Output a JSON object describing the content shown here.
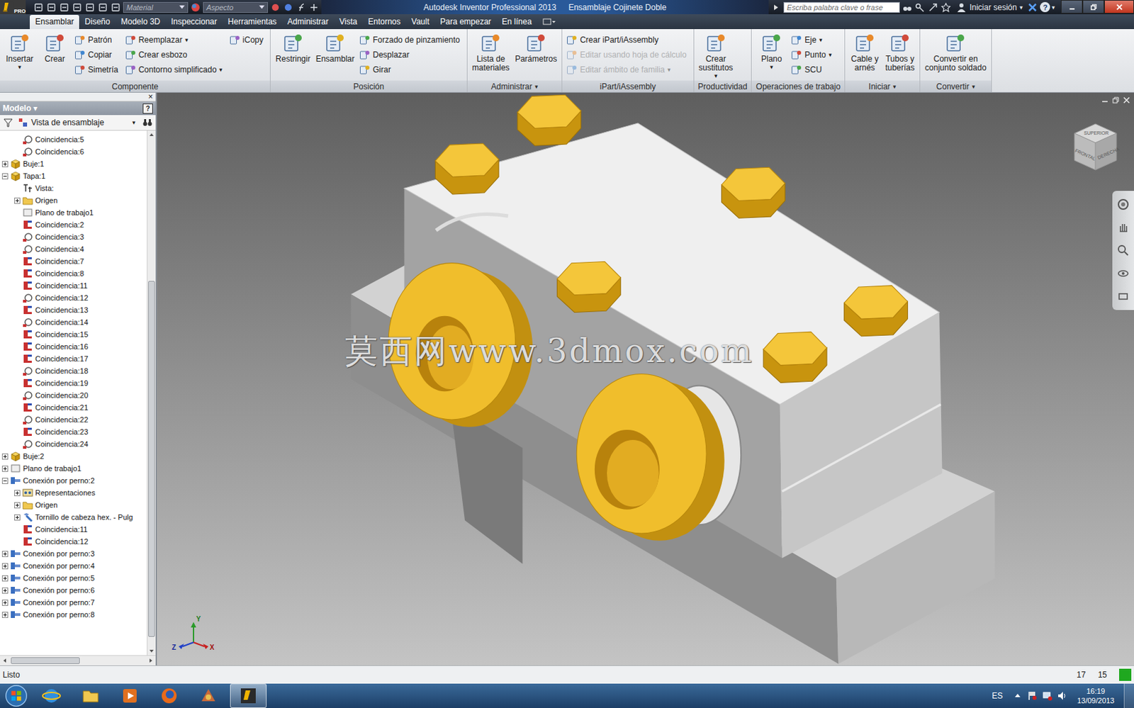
{
  "app": {
    "badge": "PRO",
    "material": "Material",
    "aspect": "Aspecto",
    "title": "Autodesk Inventor Professional 2013",
    "document": "Ensamblaje Cojinete Doble",
    "search_placeholder": "Escriba palabra clave o frase",
    "sign_in": "Iniciar sesión",
    "sign_in_arrow": "▾",
    "help": "?",
    "help_arrow": "▾"
  },
  "tabs": [
    {
      "label": "Ensamblar",
      "selected": true
    },
    {
      "label": "Diseño",
      "selected": false
    },
    {
      "label": "Modelo 3D",
      "selected": false
    },
    {
      "label": "Inspeccionar",
      "selected": false
    },
    {
      "label": "Herramientas",
      "selected": false
    },
    {
      "label": "Administrar",
      "selected": false
    },
    {
      "label": "Vista",
      "selected": false
    },
    {
      "label": "Entornos",
      "selected": false
    },
    {
      "label": "Vault",
      "selected": false
    },
    {
      "label": "Para empezar",
      "selected": false
    },
    {
      "label": "En línea",
      "selected": false
    }
  ],
  "ribbon": [
    {
      "label": "Componente",
      "arrow": "",
      "columns": [
        {
          "kind": "large",
          "buttons": [
            {
              "lines": [
                "Insertar"
              ],
              "arrow": "▾",
              "disabled": false
            }
          ]
        },
        {
          "kind": "large",
          "buttons": [
            {
              "lines": [
                "Crear"
              ],
              "arrow": "",
              "disabled": false
            }
          ]
        },
        {
          "kind": "small",
          "buttons": [
            {
              "label": "Patrón",
              "arrow": "",
              "disabled": false
            },
            {
              "label": "Copiar",
              "arrow": "",
              "disabled": false
            },
            {
              "label": "Simetría",
              "arrow": "",
              "disabled": false
            }
          ]
        },
        {
          "kind": "small",
          "buttons": [
            {
              "label": "Reemplazar",
              "arrow": "▾",
              "disabled": false
            },
            {
              "label": "Crear esbozo",
              "arrow": "",
              "disabled": false
            },
            {
              "label": "Contorno simplificado",
              "arrow": "▾",
              "disabled": false
            }
          ]
        },
        {
          "kind": "small",
          "buttons": [
            {
              "label": "iCopy",
              "arrow": "",
              "disabled": false
            }
          ]
        }
      ]
    },
    {
      "label": "Posición",
      "arrow": "",
      "columns": [
        {
          "kind": "large",
          "buttons": [
            {
              "lines": [
                "Restringir"
              ],
              "arrow": "",
              "disabled": false
            }
          ]
        },
        {
          "kind": "large",
          "buttons": [
            {
              "lines": [
                "Ensamblar"
              ],
              "arrow": "",
              "disabled": false
            }
          ]
        },
        {
          "kind": "small",
          "buttons": [
            {
              "label": "Forzado de pinzamiento",
              "arrow": "",
              "disabled": false
            },
            {
              "label": "Desplazar",
              "arrow": "",
              "disabled": false
            },
            {
              "label": "Girar",
              "arrow": "",
              "disabled": false
            }
          ]
        }
      ]
    },
    {
      "label": "Administrar",
      "arrow": "▾",
      "columns": [
        {
          "kind": "large",
          "buttons": [
            {
              "lines": [
                "Lista de",
                "materiales"
              ],
              "arrow": "",
              "disabled": false
            }
          ]
        },
        {
          "kind": "large",
          "buttons": [
            {
              "lines": [
                "Parámetros"
              ],
              "arrow": "",
              "disabled": false
            }
          ]
        }
      ]
    },
    {
      "label": "iPart/iAssembly",
      "arrow": "",
      "columns": [
        {
          "kind": "small",
          "buttons": [
            {
              "label": "Crear iPart/iAssembly",
              "arrow": "",
              "disabled": false
            },
            {
              "label": "Editar usando hoja de cálculo",
              "arrow": "",
              "disabled": true
            },
            {
              "label": "Editar ámbito de familia",
              "arrow": "▾",
              "disabled": true
            }
          ]
        }
      ]
    },
    {
      "label": "Productividad",
      "arrow": "",
      "columns": [
        {
          "kind": "large",
          "buttons": [
            {
              "lines": [
                "Crear",
                "sustitutos"
              ],
              "arrow": "▾",
              "disabled": false
            }
          ]
        }
      ]
    },
    {
      "label": "Operaciones de trabajo",
      "arrow": "",
      "columns": [
        {
          "kind": "large",
          "buttons": [
            {
              "lines": [
                "Plano"
              ],
              "arrow": "▾",
              "disabled": false
            }
          ]
        },
        {
          "kind": "small",
          "buttons": [
            {
              "label": "Eje",
              "arrow": "▾",
              "disabled": false
            },
            {
              "label": "Punto",
              "arrow": "▾",
              "disabled": false
            },
            {
              "label": "SCU",
              "arrow": "",
              "disabled": false
            }
          ]
        }
      ]
    },
    {
      "label": "Iniciar",
      "arrow": "▾",
      "columns": [
        {
          "kind": "large",
          "buttons": [
            {
              "lines": [
                "Cable y",
                "arnés"
              ],
              "arrow": "",
              "disabled": false
            }
          ]
        },
        {
          "kind": "large",
          "buttons": [
            {
              "lines": [
                "Tubos y",
                "tuberías"
              ],
              "arrow": "",
              "disabled": false
            }
          ]
        }
      ]
    },
    {
      "label": "Convertir",
      "arrow": "▾",
      "columns": [
        {
          "kind": "large",
          "buttons": [
            {
              "lines": [
                "Convertir en",
                "conjunto soldado"
              ],
              "arrow": "",
              "disabled": false
            }
          ]
        }
      ]
    }
  ],
  "browser": {
    "close": "×",
    "title": "Modelo",
    "title_arrow": "▾",
    "help": "?",
    "view": "Vista de ensamblaje",
    "view_arrow": "▾",
    "thumb_start": 0.28,
    "thumb_size": 0.7,
    "items": [
      {
        "label": "Coincidencia:5",
        "kind": "axis",
        "depth": 1,
        "expandable": false,
        "expanded": false
      },
      {
        "label": "Coincidencia:6",
        "kind": "axis",
        "depth": 1,
        "expandable": false,
        "expanded": false
      },
      {
        "label": "Buje:1",
        "kind": "part",
        "depth": 0,
        "expandable": true,
        "expanded": false
      },
      {
        "label": "Tapa:1",
        "kind": "part",
        "depth": 0,
        "expandable": true,
        "expanded": true
      },
      {
        "label": "Vista:",
        "kind": "view",
        "depth": 1,
        "expandable": false,
        "expanded": false
      },
      {
        "label": "Origen",
        "kind": "folder",
        "depth": 1,
        "expandable": true,
        "expanded": false
      },
      {
        "label": "Plano de trabajo1",
        "kind": "plane",
        "depth": 1,
        "expandable": false,
        "expanded": false
      },
      {
        "label": "Coincidencia:2",
        "kind": "flush",
        "depth": 1,
        "expandable": false,
        "expanded": false
      },
      {
        "label": "Coincidencia:3",
        "kind": "axis",
        "depth": 1,
        "expandable": false,
        "expanded": false
      },
      {
        "label": "Coincidencia:4",
        "kind": "axis",
        "depth": 1,
        "expandable": false,
        "expanded": false
      },
      {
        "label": "Coincidencia:7",
        "kind": "flush",
        "depth": 1,
        "expandable": false,
        "expanded": false
      },
      {
        "label": "Coincidencia:8",
        "kind": "flush",
        "depth": 1,
        "expandable": false,
        "expanded": false
      },
      {
        "label": "Coincidencia:11",
        "kind": "flush",
        "depth": 1,
        "expandable": false,
        "expanded": false
      },
      {
        "label": "Coincidencia:12",
        "kind": "axis",
        "depth": 1,
        "expandable": false,
        "expanded": false
      },
      {
        "label": "Coincidencia:13",
        "kind": "flush",
        "depth": 1,
        "expandable": false,
        "expanded": false
      },
      {
        "label": "Coincidencia:14",
        "kind": "axis",
        "depth": 1,
        "expandable": false,
        "expanded": false
      },
      {
        "label": "Coincidencia:15",
        "kind": "flush",
        "depth": 1,
        "expandable": false,
        "expanded": false
      },
      {
        "label": "Coincidencia:16",
        "kind": "flush",
        "depth": 1,
        "expandable": false,
        "expanded": false
      },
      {
        "label": "Coincidencia:17",
        "kind": "flush",
        "depth": 1,
        "expandable": false,
        "expanded": false
      },
      {
        "label": "Coincidencia:18",
        "kind": "axis",
        "depth": 1,
        "expandable": false,
        "expanded": false
      },
      {
        "label": "Coincidencia:19",
        "kind": "flush",
        "depth": 1,
        "expandable": false,
        "expanded": false
      },
      {
        "label": "Coincidencia:20",
        "kind": "axis",
        "depth": 1,
        "expandable": false,
        "expanded": false
      },
      {
        "label": "Coincidencia:21",
        "kind": "flush",
        "depth": 1,
        "expandable": false,
        "expanded": false
      },
      {
        "label": "Coincidencia:22",
        "kind": "axis",
        "depth": 1,
        "expandable": false,
        "expanded": false
      },
      {
        "label": "Coincidencia:23",
        "kind": "flush",
        "depth": 1,
        "expandable": false,
        "expanded": false
      },
      {
        "label": "Coincidencia:24",
        "kind": "axis",
        "depth": 1,
        "expandable": false,
        "expanded": false
      },
      {
        "label": "Buje:2",
        "kind": "part",
        "depth": 0,
        "expandable": true,
        "expanded": false
      },
      {
        "label": "Plano de trabajo1",
        "kind": "plane",
        "depth": 0,
        "expandable": true,
        "expanded": false
      },
      {
        "label": "Conexión por perno:2",
        "kind": "bolt",
        "depth": 0,
        "expandable": true,
        "expanded": true
      },
      {
        "label": "Representaciones",
        "kind": "repr",
        "depth": 1,
        "expandable": true,
        "expanded": false
      },
      {
        "label": "Origen",
        "kind": "folder",
        "depth": 1,
        "expandable": true,
        "expanded": false
      },
      {
        "label": "Tornillo de cabeza hex. - Pulg",
        "kind": "screw",
        "depth": 1,
        "expandable": true,
        "expanded": false
      },
      {
        "label": "Coincidencia:11",
        "kind": "flush",
        "depth": 1,
        "expandable": false,
        "expanded": false
      },
      {
        "label": "Coincidencia:12",
        "kind": "flush",
        "depth": 1,
        "expandable": false,
        "expanded": false
      },
      {
        "label": "Conexión por perno:3",
        "kind": "bolt",
        "depth": 0,
        "expandable": true,
        "expanded": false
      },
      {
        "label": "Conexión por perno:4",
        "kind": "bolt",
        "depth": 0,
        "expandable": true,
        "expanded": false
      },
      {
        "label": "Conexión por perno:5",
        "kind": "bolt",
        "depth": 0,
        "expandable": true,
        "expanded": false
      },
      {
        "label": "Conexión por perno:6",
        "kind": "bolt",
        "depth": 0,
        "expandable": true,
        "expanded": false
      },
      {
        "label": "Conexión por perno:7",
        "kind": "bolt",
        "depth": 0,
        "expandable": true,
        "expanded": false
      },
      {
        "label": "Conexión por perno:8",
        "kind": "bolt",
        "depth": 0,
        "expandable": true,
        "expanded": false
      }
    ]
  },
  "viewport": {
    "watermark": "莫西网www.3dmox.com",
    "viewcube": {
      "top": "SUPERIOR",
      "front": "FRONTAL",
      "right": "DERECHA"
    },
    "axes": {
      "x": "X",
      "y": "Y",
      "z": "Z"
    }
  },
  "status": {
    "text": "Listo",
    "numbers": [
      "17",
      "15"
    ]
  },
  "taskbar": {
    "language": "ES",
    "time": "16:19",
    "date": "13/09/2013",
    "apps": [
      {
        "kind": "ie",
        "selected": false
      },
      {
        "kind": "explorer",
        "selected": false
      },
      {
        "kind": "media",
        "selected": false
      },
      {
        "kind": "firefox",
        "selected": false
      },
      {
        "kind": "paint",
        "selected": false
      },
      {
        "kind": "inventor",
        "selected": true
      }
    ]
  }
}
